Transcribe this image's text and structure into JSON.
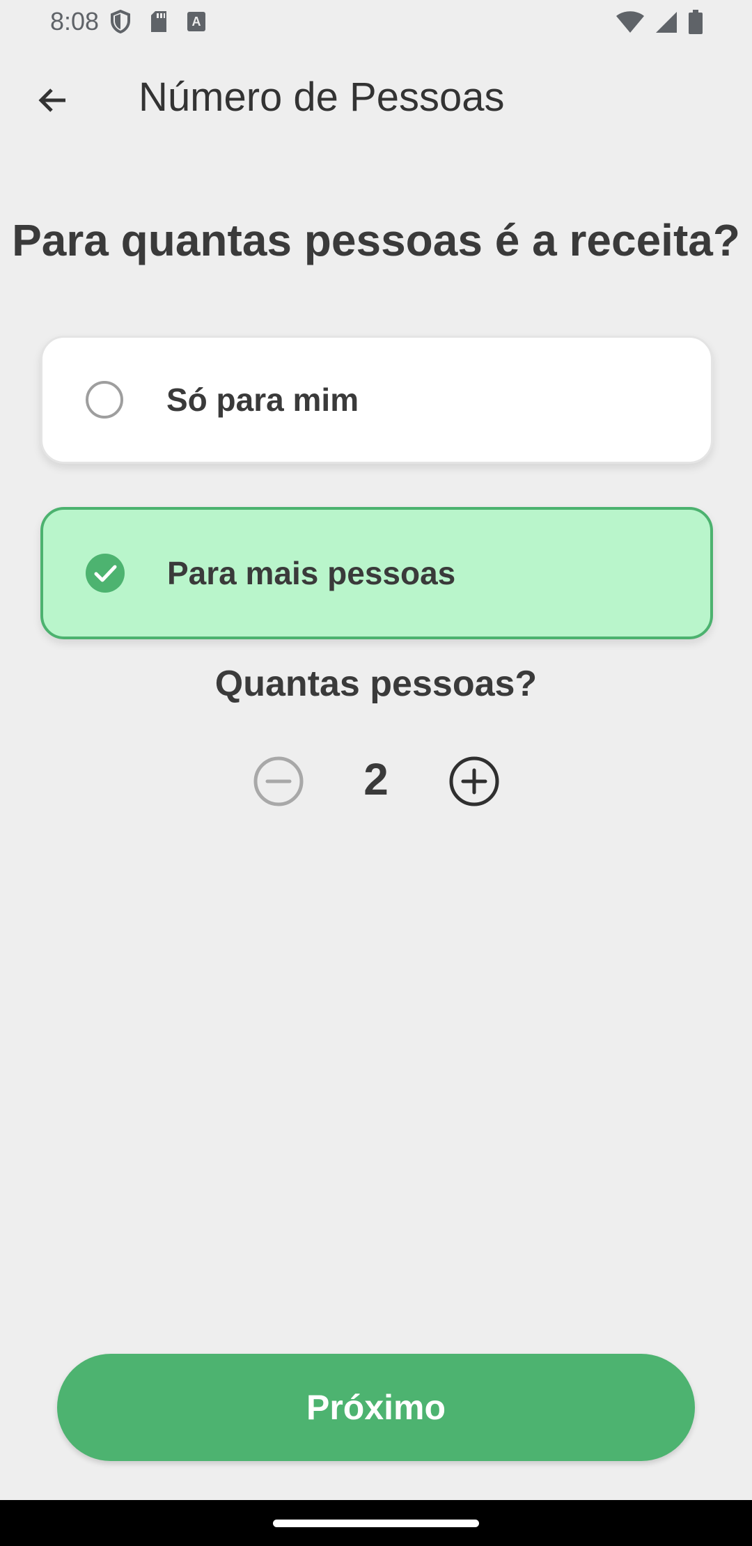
{
  "status_bar": {
    "time": "8:08",
    "left_icons": [
      "shield-icon",
      "sd-card-icon",
      "keyboard-a-icon"
    ],
    "right_icons": [
      "wifi-icon",
      "signal-icon",
      "battery-icon"
    ]
  },
  "app_bar": {
    "back_icon": "arrow-left-icon",
    "title": "Número de Pessoas"
  },
  "question": "Para quantas pessoas é a receita?",
  "options": [
    {
      "label": "Só para mim",
      "selected": false
    },
    {
      "label": "Para mais pessoas",
      "selected": true
    }
  ],
  "people": {
    "question": "Quantas pessoas?",
    "count": "2",
    "minus_enabled": false,
    "plus_enabled": true
  },
  "next_button": {
    "label": "Próximo"
  },
  "colors": {
    "accent": "#4db370",
    "selected_bg": "#b9f5cb",
    "background": "#eeeeee"
  }
}
